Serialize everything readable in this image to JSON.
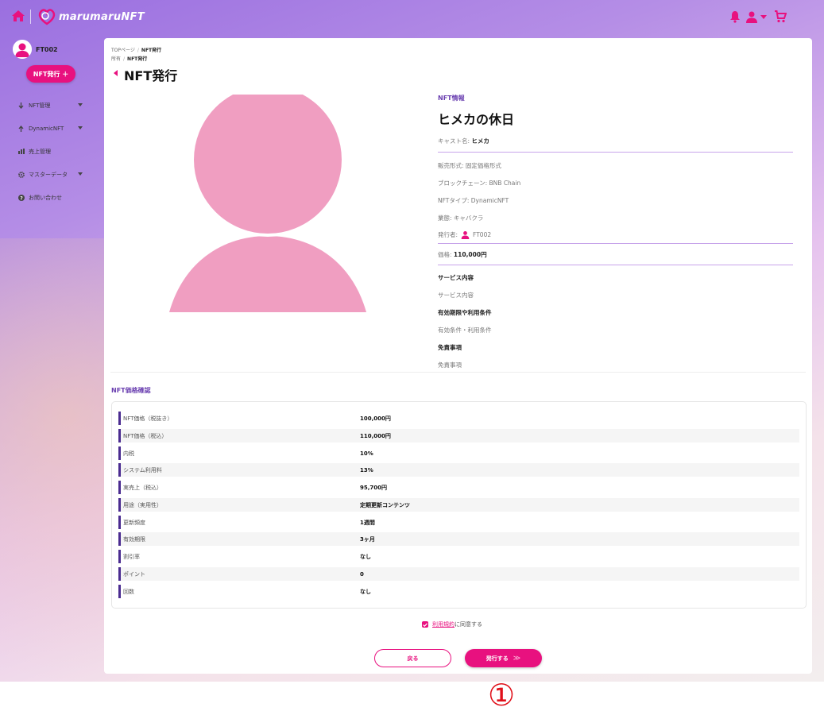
{
  "header": {
    "logo_text": "marumaruNFT",
    "icons": [
      "home-icon",
      "bell-icon",
      "user-icon",
      "cart-icon"
    ]
  },
  "sidebar": {
    "user_name": "FT002",
    "issue_button": "NFT発行 ＋",
    "items": [
      {
        "label": "NFT管理",
        "icon": "down-arrow-icon",
        "has_submenu": true
      },
      {
        "label": "DynamicNFT",
        "icon": "up-arrow-icon",
        "has_submenu": true
      },
      {
        "label": "売上管理",
        "icon": "bar-chart-icon",
        "has_submenu": false
      },
      {
        "label": "マスターデータ",
        "icon": "gear-icon",
        "has_submenu": true
      },
      {
        "label": "お問い合わせ",
        "icon": "question-icon",
        "has_submenu": false
      }
    ]
  },
  "breadcrumb": {
    "line1": [
      "TOPページ",
      "NFT発行"
    ],
    "line2": [
      "所有",
      "NFT発行"
    ]
  },
  "page_title": "NFT発行",
  "nft_info": {
    "section_label": "NFT情報",
    "name": "ヒメカの休日",
    "cast_label": "キャスト名:",
    "cast_value": "ヒメカ",
    "sale_format": "販売形式: 固定価格形式",
    "blockchain": "ブロックチェーン: BNB Chain",
    "nft_type": "NFTタイプ: DynamicNFT",
    "industry": "業態: キャバクラ",
    "issuer_label": "発行者:",
    "issuer_value": "FT002",
    "price_label": "価格:",
    "price_value": "110,000円",
    "service_title": "サービス内容",
    "service_text": "サービス内容",
    "validity_title": "有効期限や利用条件",
    "validity_text": "有効条件・利用条件",
    "disclaimer_title": "免責事項",
    "disclaimer_text": "免責事項"
  },
  "price_confirm": {
    "title": "NFT価格確認",
    "rows": [
      {
        "label": "NFT価格（税抜き）",
        "value": "100,000円"
      },
      {
        "label": "NFT価格（税込）",
        "value": "110,000円"
      },
      {
        "label": "内税",
        "value": "10%"
      },
      {
        "label": "システム利用料",
        "value": "13%"
      },
      {
        "label": "実売上（税込）",
        "value": "95,700円"
      },
      {
        "label": "用途（実用性）",
        "value": "定期更新コンテンツ"
      },
      {
        "label": "更新頻度",
        "value": "1週間"
      },
      {
        "label": "有効期限",
        "value": "3ヶ月"
      },
      {
        "label": "割引率",
        "value": "なし"
      },
      {
        "label": "ポイント",
        "value": "0"
      },
      {
        "label": "回数",
        "value": "なし"
      }
    ]
  },
  "agreement": {
    "checked": true,
    "link_text": "利用規約",
    "suffix": "に同意する"
  },
  "buttons": {
    "back": "戻る",
    "issue": "発行する",
    "issue_icon": "double-chevron-right-icon"
  },
  "step_marker": "①",
  "colors": {
    "accent": "#e8117f",
    "purple": "#6a3fb0",
    "placeholder": "#f09ec1",
    "step_red": "#e0101a"
  }
}
